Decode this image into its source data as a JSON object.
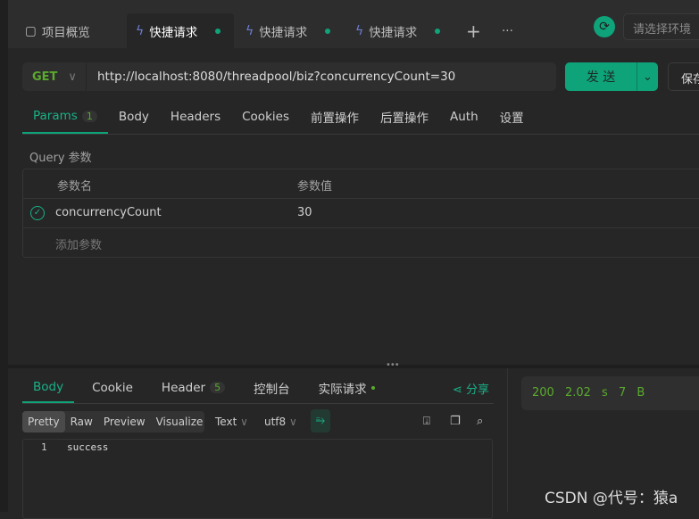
{
  "tabs": [
    {
      "label": "项目概览",
      "icon": "layout-icon"
    },
    {
      "label": "快捷请求",
      "icon": "bolt-icon",
      "active": true
    },
    {
      "label": "快捷请求",
      "icon": "bolt-icon"
    },
    {
      "label": "快捷请求",
      "icon": "bolt-icon"
    }
  ],
  "tab_add": "+",
  "tab_more": "···",
  "env_placeholder": "请选择环境",
  "request": {
    "method": "GET",
    "url": "http://localhost:8080/threadpool/biz?concurrencyCount=30",
    "send": "发 送",
    "save": "保存"
  },
  "req_tabs": [
    {
      "label": "Params",
      "badge": "1"
    },
    {
      "label": "Body"
    },
    {
      "label": "Headers"
    },
    {
      "label": "Cookies"
    },
    {
      "label": "前置操作"
    },
    {
      "label": "后置操作"
    },
    {
      "label": "Auth"
    },
    {
      "label": "设置"
    }
  ],
  "query": {
    "label": "Query 参数",
    "headers": [
      "参数名",
      "参数值"
    ],
    "rows": [
      {
        "name": "concurrencyCount",
        "value": "30",
        "enabled": true
      }
    ],
    "add": "添加参数"
  },
  "resp_tabs": [
    {
      "label": "Body"
    },
    {
      "label": "Cookie"
    },
    {
      "label": "Header",
      "badge": "5"
    },
    {
      "label": "控制台"
    },
    {
      "label": "实际请求"
    }
  ],
  "share": "分享",
  "formats": [
    "Pretty",
    "Raw",
    "Preview",
    "Visualize"
  ],
  "type_select": "Text",
  "encoding_select": "utf8",
  "body": {
    "line": "1",
    "text": "success"
  },
  "status": {
    "code": "200",
    "time": "2.02 s",
    "size": "7 B"
  },
  "watermark": "CSDN @代号：猿a",
  "colors": {
    "accent": "#0fa37a",
    "method": "#5aaa2e"
  }
}
